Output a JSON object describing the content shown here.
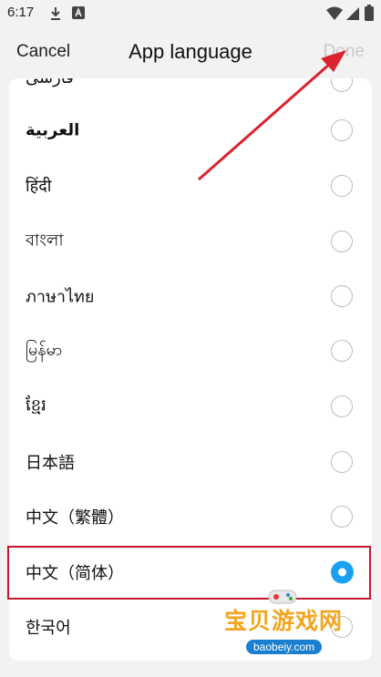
{
  "status_bar": {
    "time": "6:17"
  },
  "header": {
    "cancel_label": "Cancel",
    "title": "App language",
    "done_label": "Done"
  },
  "languages": [
    {
      "label": "فارسی",
      "selected": false
    },
    {
      "label": "العربية",
      "selected": false
    },
    {
      "label": "हिंदी",
      "selected": false
    },
    {
      "label": "বাংলা",
      "selected": false
    },
    {
      "label": "ภาษาไทย",
      "selected": false
    },
    {
      "label": "မြန်မာ",
      "selected": false
    },
    {
      "label": "ខ្មែរ",
      "selected": false
    },
    {
      "label": "日本語",
      "selected": false
    },
    {
      "label": "中文（繁體）",
      "selected": false
    },
    {
      "label": "中文（简体）",
      "selected": true
    },
    {
      "label": "한국어",
      "selected": false
    }
  ],
  "watermark": {
    "text": "宝贝游戏网",
    "url": "baobeiy.com"
  },
  "colors": {
    "accent": "#1aa0f0",
    "annotation": "#c4182a",
    "done_disabled": "#c9c9c9"
  }
}
